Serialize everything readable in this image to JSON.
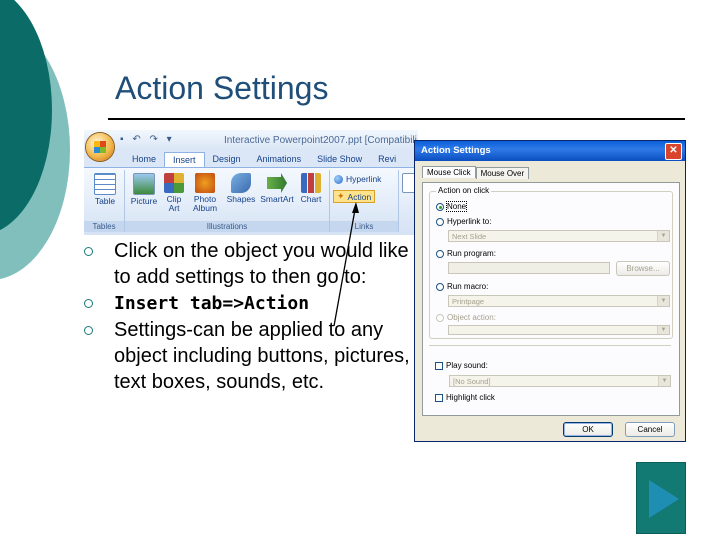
{
  "slide": {
    "title": "Action Settings",
    "bullets": [
      {
        "text": "Click on the object you would like to add settings to then go to:",
        "bold": false
      },
      {
        "text": "Insert tab=>Action",
        "bold": true
      },
      {
        "text": "Settings-can be applied to any object including buttons, pictures, text boxes, sounds, etc.",
        "bold": false
      }
    ]
  },
  "colors": {
    "teal_dark": "#0b6b66",
    "teal_light": "#1a8a86",
    "title": "#1f4e79",
    "bullet_mark": "#1a7a78",
    "next_button": "#127a73",
    "next_arrow": "#1e8fb3"
  },
  "ribbon": {
    "window_title": "Interactive Powerpoint2007.ppt [Compatibili",
    "tabs": [
      "Home",
      "Insert",
      "Design",
      "Animations",
      "Slide Show",
      "Revi"
    ],
    "active_tab": "Insert",
    "groups": {
      "tables": {
        "label": "Tables",
        "buttons": [
          "Table"
        ]
      },
      "illustrations": {
        "label": "Illustrations",
        "buttons": [
          "Picture",
          "Clip Art",
          "Photo Album",
          "Shapes",
          "SmartArt",
          "Chart"
        ]
      },
      "links": {
        "label": "Links",
        "buttons": [
          "Hyperlink",
          "Action"
        ]
      }
    }
  },
  "dialog": {
    "title": "Action Settings",
    "close_icon": "close-icon",
    "tabs": [
      "Mouse Click",
      "Mouse Over"
    ],
    "active_tab": "Mouse Click",
    "group_label": "Action on click",
    "options": {
      "none": "None",
      "hyperlink": "Hyperlink to:",
      "hyperlink_value": "Next Slide",
      "run_program": "Run program:",
      "browse": "Browse...",
      "run_macro": "Run macro:",
      "macro_value": "Printpage",
      "object_action": "Object action:",
      "play_sound": "Play sound:",
      "sound_value": "[No Sound]",
      "highlight_click": "Highlight click"
    },
    "selected_option": "None",
    "ok": "OK",
    "cancel": "Cancel"
  },
  "navigation": {
    "next_icon": "play-arrow-icon"
  }
}
